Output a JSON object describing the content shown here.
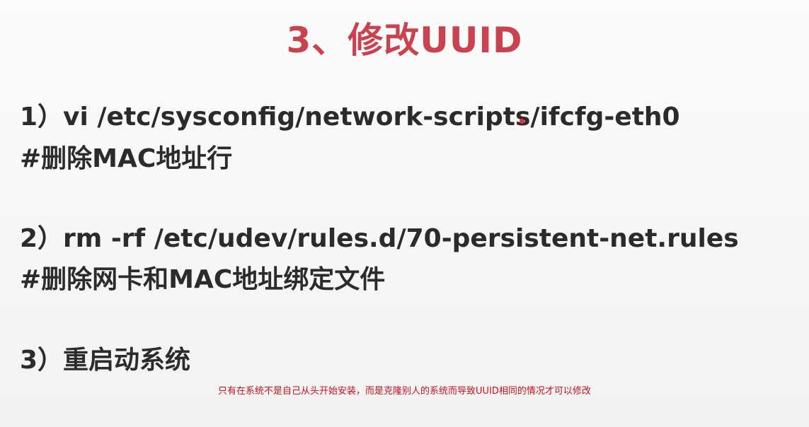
{
  "slide": {
    "title": "3、修改UUID",
    "lines": [
      "1）vi /etc/sysconfig/network-scripts/ifcfg-eth0",
      "#删除MAC地址行",
      "2）rm  -rf  /etc/udev/rules.d/70-persistent-net.rules",
      "#删除网卡和MAC地址绑定文件",
      "3）重启动系统"
    ],
    "subtitle": "只有在系统不是自己从头开始安装，而是克隆别人的系统而导致UUID相同的情况才可以修改"
  },
  "colors": {
    "title": "#c8434f",
    "body_text": "#2b2b2b",
    "subtitle": "#c0121a",
    "pointer_dot": "#e8302f"
  }
}
